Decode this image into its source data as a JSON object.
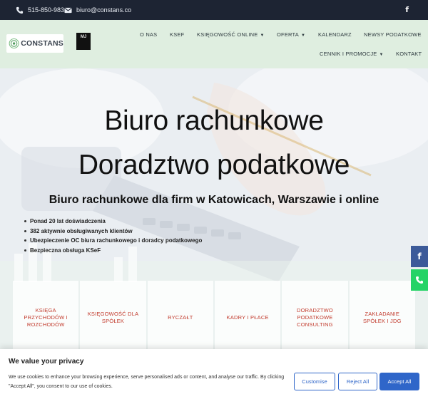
{
  "topbar": {
    "phone": "515-850-983",
    "email": "biuro@constans.co",
    "phone_icon": "phone-icon",
    "email_icon": "envelope-icon",
    "social_icon": "facebook-icon"
  },
  "header": {
    "logo_text": "CONSTANS",
    "badge_text": "MJ",
    "nav_row1": [
      "O NAS",
      "KSEF",
      "KSIĘGOWOŚĆ ONLINE",
      "OFERTA",
      "KALENDARZ",
      "NEWSY PODATKOWE"
    ],
    "nav_row2": [
      "CENNIK I PROMOCJE",
      "KONTAKT"
    ]
  },
  "hero": {
    "title_line1": "Biuro rachunkowe",
    "title_line2": "Doradztwo podatkowe",
    "subtitle": "Biuro rachunkowe dla firm w Katowicach, Warszawie i online",
    "bullets": [
      "Ponad 20 lat doświadczenia",
      "382 aktywnie obsługiwanych klientów",
      "Ubezpieczenie OC biura rachunkowego i doradcy podatkowego",
      "Bezpieczna obsługa KSeF"
    ]
  },
  "cards": [
    "KSIĘGA PRZYCHODÓW I ROZCHODÓW",
    "KSIĘGOWOŚĆ DLA SPÓŁEK",
    "RYCZAŁT",
    "KADRY I PŁACE",
    "DORADZTWO PODATKOWE CONSULTING",
    "ZAKŁADANIE SPÓŁEK I JDG"
  ],
  "cookie": {
    "title": "We value your privacy",
    "text": "We use cookies to enhance your browsing experience, serve personalised ads or content, and analyse our traffic. By clicking \"Accept All\", you consent to our use of cookies.",
    "customise": "Customise",
    "reject": "Reject All",
    "accept": "Accept All"
  },
  "colors": {
    "topbar_bg": "#1d2433",
    "header_bg": "#dfeee0",
    "card_text": "#c23a2c",
    "button_blue": "#2f66c9",
    "facebook": "#3c5a99",
    "whatsapp": "#25d366"
  }
}
